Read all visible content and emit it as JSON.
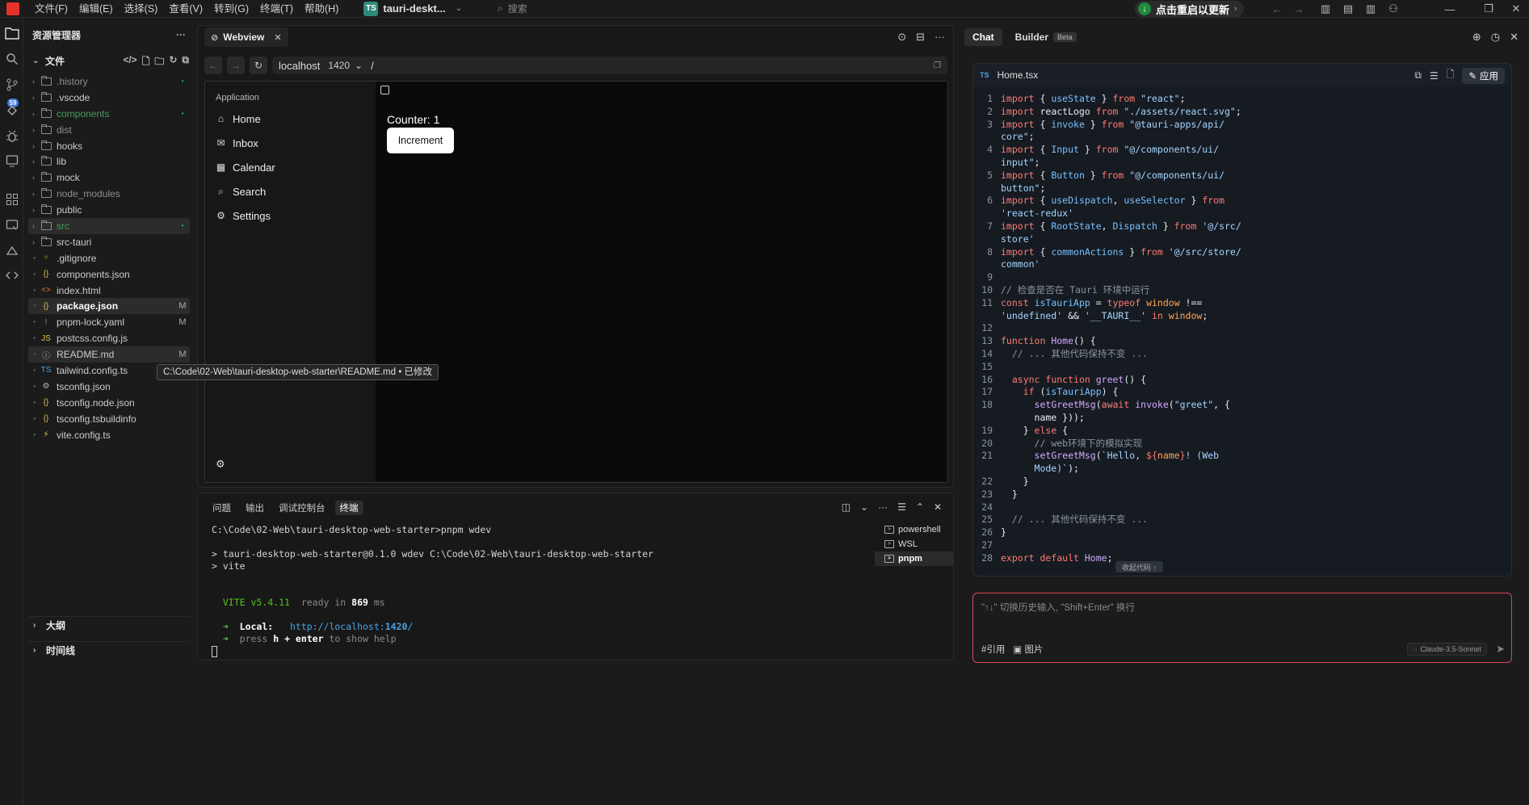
{
  "titlebar": {
    "menu": [
      "文件(F)",
      "编辑(E)",
      "选择(S)",
      "查看(V)",
      "转到(G)",
      "终端(T)",
      "帮助(H)"
    ],
    "project_badge": "TS",
    "project_name": "tauri-deskt...",
    "search_placeholder": "搜索",
    "update_label": "点击重启以更新"
  },
  "activity": {
    "badge": "59"
  },
  "sidebar": {
    "title": "资源管理器",
    "section": "文件",
    "items": [
      {
        "name": ".history",
        "type": "folder",
        "style": "dim",
        "status": "•"
      },
      {
        "name": ".vscode",
        "type": "folder",
        "style": "",
        "status": ""
      },
      {
        "name": "components",
        "type": "folder",
        "style": "green",
        "status": "•"
      },
      {
        "name": "dist",
        "type": "folder",
        "style": "dim",
        "status": ""
      },
      {
        "name": "hooks",
        "type": "folder",
        "style": "",
        "status": ""
      },
      {
        "name": "lib",
        "type": "folder",
        "style": "",
        "status": ""
      },
      {
        "name": "mock",
        "type": "folder",
        "style": "",
        "status": ""
      },
      {
        "name": "node_modules",
        "type": "folder",
        "style": "dim",
        "status": ""
      },
      {
        "name": "public",
        "type": "folder",
        "style": "",
        "status": ""
      },
      {
        "name": "src",
        "type": "folder",
        "style": "green",
        "status": "•",
        "selected": true
      },
      {
        "name": "src-tauri",
        "type": "folder",
        "style": "",
        "status": ""
      },
      {
        "name": ".gitignore",
        "type": "git",
        "style": "",
        "status": ""
      },
      {
        "name": "components.json",
        "type": "json",
        "style": "",
        "status": ""
      },
      {
        "name": "index.html",
        "type": "html",
        "style": "",
        "status": ""
      },
      {
        "name": "package.json",
        "type": "json",
        "style": "bold",
        "status": "M",
        "selected": true
      },
      {
        "name": "pnpm-lock.yaml",
        "type": "yaml",
        "style": "",
        "status": "M"
      },
      {
        "name": "postcss.config.js",
        "type": "js",
        "style": "",
        "status": ""
      },
      {
        "name": "README.md",
        "type": "info",
        "style": "",
        "status": "M",
        "selected": true
      },
      {
        "name": "tailwind.config.ts",
        "type": "ts",
        "style": "",
        "status": ""
      },
      {
        "name": "tsconfig.json",
        "type": "gear",
        "style": "",
        "status": ""
      },
      {
        "name": "tsconfig.node.json",
        "type": "json",
        "style": "",
        "status": ""
      },
      {
        "name": "tsconfig.tsbuildinfo",
        "type": "json",
        "style": "",
        "status": ""
      },
      {
        "name": "vite.config.ts",
        "type": "vite",
        "style": "",
        "status": ""
      }
    ],
    "outline": "大纲",
    "timeline": "时间线"
  },
  "tooltip": "C:\\Code\\02-Web\\tauri-desktop-web-starter\\README.md • 已修改",
  "editor": {
    "tab": "Webview",
    "url_host": "localhost",
    "url_port": "1420",
    "url_path": "/",
    "webview": {
      "app_label": "Application",
      "nav": [
        "Home",
        "Inbox",
        "Calendar",
        "Search",
        "Settings"
      ],
      "counter": "Counter: 1",
      "button": "Increment"
    }
  },
  "panel": {
    "tabs": [
      "问题",
      "输出",
      "调试控制台",
      "终端"
    ],
    "active_tab": 3,
    "shells": [
      "powershell",
      "WSL",
      "pnpm"
    ],
    "terminal": {
      "prompt": "C:\\Code\\02-Web\\tauri-desktop-web-starter>pnpm wdev",
      "line2": "> tauri-desktop-web-starter@0.1.0 wdev C:\\Code\\02-Web\\tauri-desktop-web-starter",
      "line3": "> vite",
      "vite": "VITE v5.4.11",
      "ready": "ready in",
      "ready_ms": "869",
      "ms": "ms",
      "local_label": "Local:",
      "local_url_base": "http://localhost:",
      "local_url_port": "1420",
      "local_url_end": "/",
      "help_a": "press",
      "help_h": "h + enter",
      "help_b": "to show help"
    }
  },
  "chat": {
    "tabs": [
      "Chat",
      "Builder"
    ],
    "beta": "Beta",
    "file_badge": "TS",
    "file_name": "Home.tsx",
    "apply": "应用",
    "collapse": "收起代码 ↑",
    "input_placeholder": "\"↑↓\" 切换历史输入, \"Shift+Enter\" 换行",
    "ref": "#引用",
    "image": "图片",
    "model": "Claude-3.5-Sonnet"
  }
}
